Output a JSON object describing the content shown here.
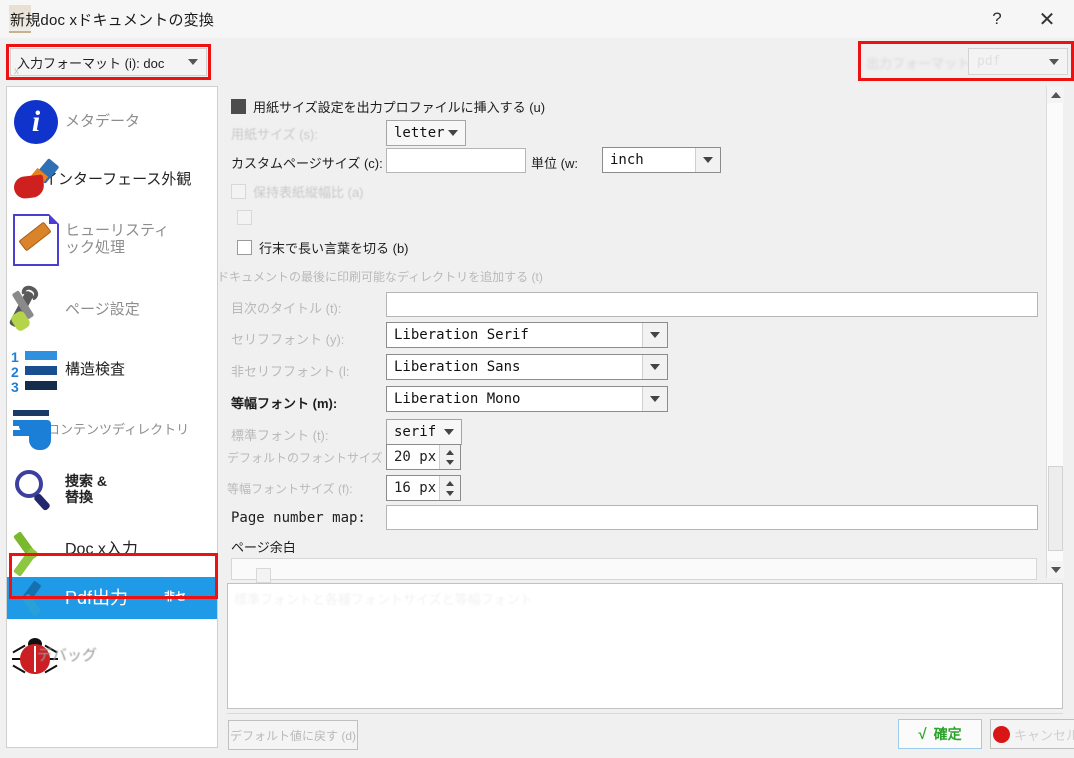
{
  "window": {
    "title": "新規doc xドキュメントの変換",
    "help_label": "?",
    "close_label": "✕"
  },
  "input_format": {
    "label": "入力フォーマット (i): doc",
    "ghost_sub": "x",
    "highlight_color": "#ee1111"
  },
  "output_format": {
    "label": "出力フォーマット (o):",
    "value": "pdf"
  },
  "sidebar": {
    "items": [
      {
        "label": "メタデータ",
        "icon": "info-icon",
        "selected": false
      },
      {
        "label": "インターフェース外観",
        "icon": "paintbrush-icon",
        "selected": false
      },
      {
        "label": "ヒューリスティ\nック処理",
        "icon": "document-bandage-icon",
        "selected": false
      },
      {
        "label": "ページ設定",
        "icon": "tools-icon",
        "selected": false
      },
      {
        "label": "構造検査",
        "icon": "numbered-list-icon",
        "selected": false
      },
      {
        "label": "コンテンツディレクトリ",
        "icon": "table-of-contents-icon",
        "selected": false
      },
      {
        "label": "捜索 &\n替換",
        "icon": "magnifier-icon",
        "selected": false
      },
      {
        "label": "Doc x入力",
        "icon": "green-chevron-icon",
        "selected": false
      },
      {
        "label": "Pdf出力",
        "icon": "blue-chevron-icon",
        "selected": true
      },
      {
        "label": "デバッグ",
        "icon": "bug-icon",
        "selected": false
      }
    ],
    "ghost_overlay": "非セ"
  },
  "main": {
    "insert_paper_size": {
      "label": "用紙サイズ設定を出力プロファイルに挿入する (u)",
      "checked": true
    },
    "paper_size": {
      "label": "用紙サイズ (s):",
      "value": "letter"
    },
    "custom_page_size": {
      "label": "カスタムページサイズ (c):",
      "value": ""
    },
    "unit": {
      "label": "単位 (w:",
      "value": "inch"
    },
    "keep_cover_aspect": {
      "label": "保持表紙縦幅比 (a)",
      "checked": false
    },
    "ghost_checkbox": {
      "label": "",
      "checked": false
    },
    "break_long_words": {
      "label": "行末で長い言葉を切る (b)",
      "checked": false
    },
    "append_printable_toc": {
      "label": "ドキュメントの最後に印刷可能なディレクトリを追加する (t)"
    },
    "toc_title": {
      "label": "目次のタイトル (t):",
      "value": ""
    },
    "serif_font": {
      "label": "セリフフォント (y):",
      "value": "Liberation Serif"
    },
    "sans_font": {
      "label": "非セリフフォント (l:",
      "value": "Liberation Sans"
    },
    "mono_font": {
      "label": "等幅フォント (m):",
      "value": "Liberation Mono"
    },
    "standard_font": {
      "label": "標準フォント (t):",
      "value": "serif"
    },
    "default_font_size": {
      "label": "デフォルトのフォントサイズ (z):",
      "value": "20 px"
    },
    "mono_font_size": {
      "label": "等幅フォントサイズ (f):",
      "value": "16 px"
    },
    "page_number_map": {
      "label": "Page number map:",
      "value": ""
    },
    "page_margin": {
      "label": "ページ余白"
    }
  },
  "log": {
    "ghost_text": "標準フォントと各種フォントサイズと等幅フォント"
  },
  "footer": {
    "restore_defaults": "デフォルト値に戻す (d)",
    "ok": "確定",
    "ok_icon": "√",
    "cancel": "キャンセル"
  }
}
